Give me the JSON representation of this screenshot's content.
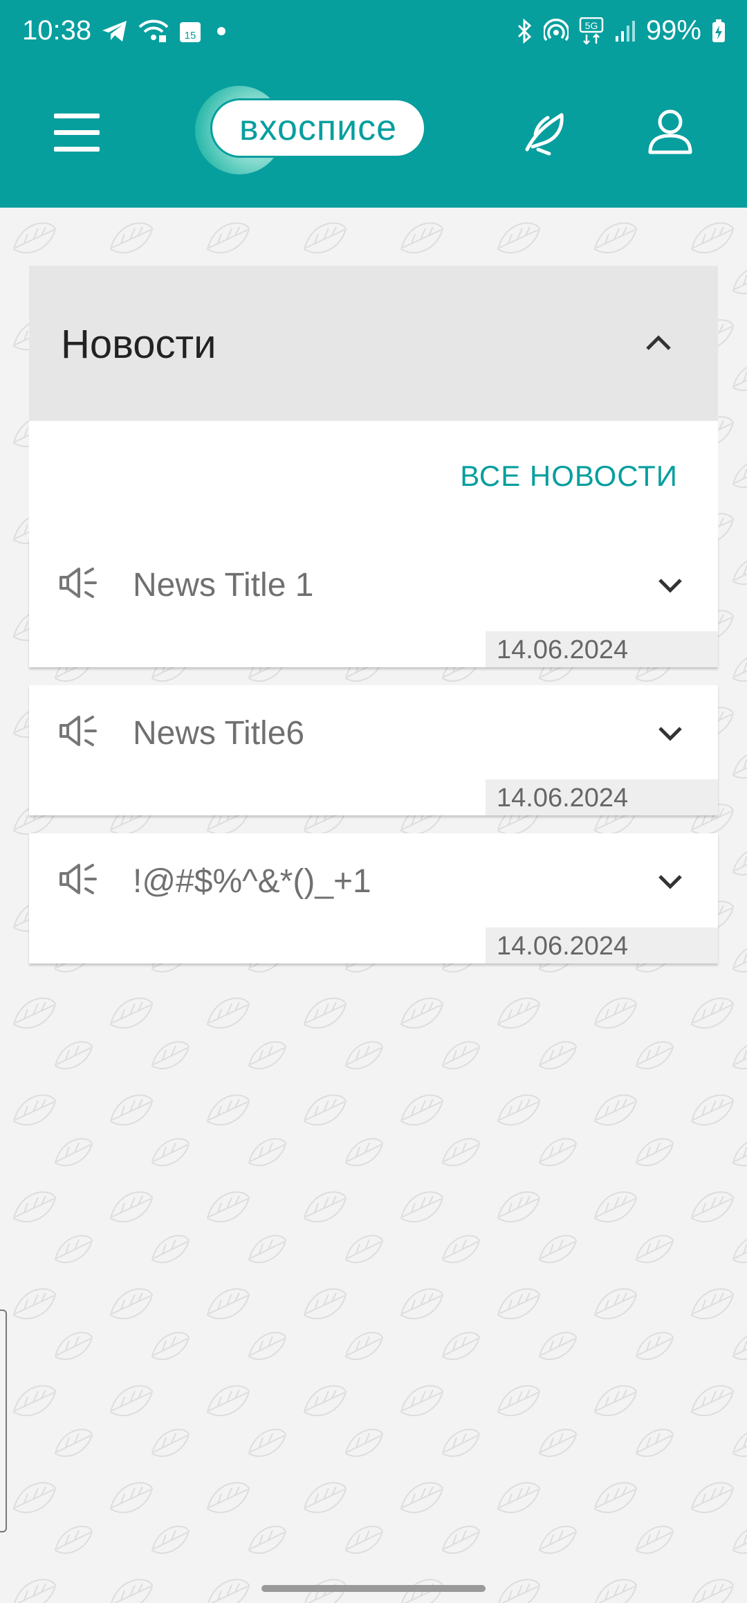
{
  "status_bar": {
    "time": "10:38",
    "battery": "99%",
    "calendar_day": "15",
    "network_label": "5G",
    "icons": [
      "telegram-icon",
      "wifi-calling-icon",
      "calendar-icon",
      "notification-dot",
      "bluetooth-icon",
      "hotspot-icon",
      "5g-icon",
      "signal-icon",
      "battery-charging-icon"
    ]
  },
  "app_bar": {
    "logo_text": "вхосписе",
    "icons": [
      "menu-icon",
      "quill-icon",
      "profile-icon"
    ],
    "color": "#079e9e"
  },
  "news_section": {
    "title": "Новости",
    "all_news_label": "ВСЕ НОВОСТИ",
    "items": [
      {
        "title": "News Title 1",
        "date": "14.06.2024"
      },
      {
        "title": "News Title6",
        "date": "14.06.2024"
      },
      {
        "title": "!@#$%^&*()_+1",
        "date": "14.06.2024"
      }
    ]
  },
  "colors": {
    "accent": "#079e9e",
    "header_bg": "#e6e6e6",
    "page_bg": "#f3f3f3"
  }
}
